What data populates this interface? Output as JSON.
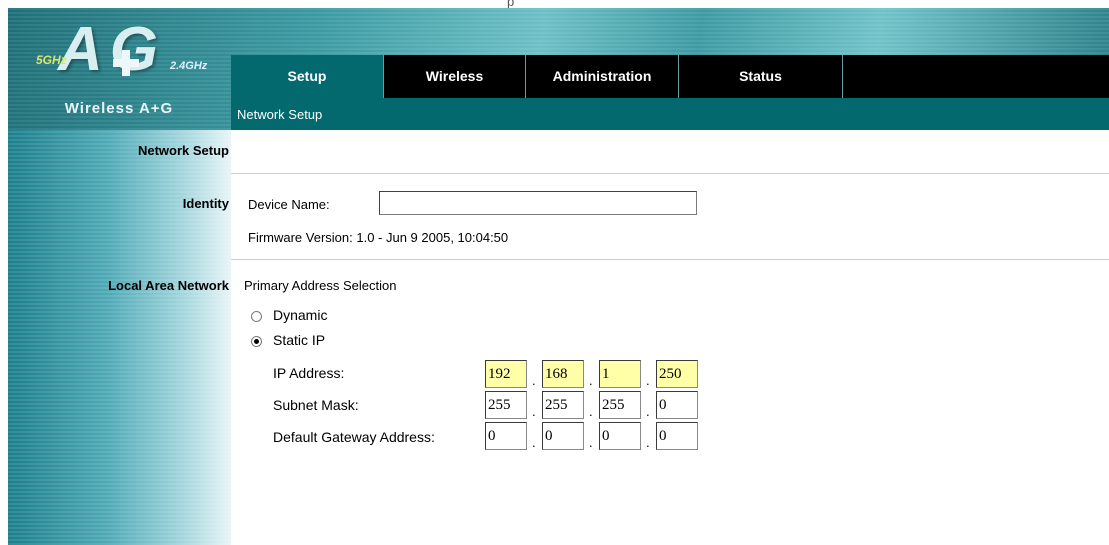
{
  "brand": {
    "logo_letters": "A G",
    "band_5ghz": "5GHz",
    "band_24ghz": "2.4GHz",
    "name": "Wireless A+G"
  },
  "nav": {
    "tabs": [
      "Setup",
      "Wireless",
      "Administration",
      "Status"
    ],
    "active_tab": "Setup",
    "subnav": "Network Setup"
  },
  "sidebar": {
    "network_setup": "Network Setup",
    "identity": "Identity",
    "lan": "Local Area Network"
  },
  "identity": {
    "device_name_label": "Device Name:",
    "device_name_value": "",
    "firmware": "Firmware Version: 1.0 - Jun 9 2005, 10:04:50"
  },
  "lan": {
    "primary_selection_label": "Primary Address Selection",
    "dynamic_label": "Dynamic",
    "static_label": "Static IP",
    "selected_mode": "Static IP",
    "ip_label": "IP Address:",
    "subnet_label": "Subnet Mask:",
    "gateway_label": "Default Gateway Address:",
    "ip": [
      "192",
      "168",
      "1",
      "250"
    ],
    "subnet": [
      "255",
      "255",
      "255",
      "0"
    ],
    "gateway": [
      "0",
      "0",
      "0",
      "0"
    ]
  },
  "colors": {
    "nav_background": "#000000",
    "active_tab": "#04696f",
    "highlight_input": "#ffffa8"
  }
}
